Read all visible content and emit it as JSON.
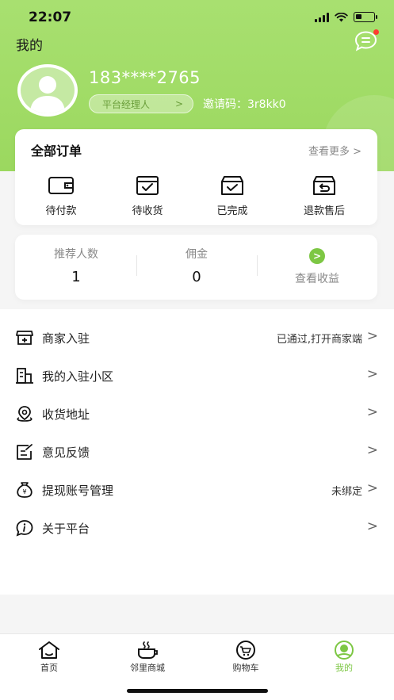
{
  "status_bar": {
    "time": "22:07"
  },
  "header": {
    "title": "我的",
    "icons": [
      "message-icon"
    ]
  },
  "profile": {
    "username": "183****2765",
    "role": "平台经理人",
    "role_chevron": ">",
    "invite_label": "邀请码：",
    "invite_code": "3r8kk0"
  },
  "orders": {
    "title": "全部订单",
    "view_more": "查看更多 >",
    "items": [
      {
        "label": "待付款",
        "icon": "wallet-icon"
      },
      {
        "label": "待收货",
        "icon": "box-check-icon"
      },
      {
        "label": "已完成",
        "icon": "box-done-icon"
      },
      {
        "label": "退款售后",
        "icon": "return-icon"
      }
    ]
  },
  "earnings": {
    "referrals_label": "推荐人数",
    "referrals_value": "1",
    "commission_label": "佣金",
    "commission_value": "0",
    "view_income_icon": ">",
    "view_income_label": "查看收益"
  },
  "menu": [
    {
      "label": "商家入驻",
      "value": "已通过,打开商家端",
      "icon": "merchant-icon"
    },
    {
      "label": "我的入驻小区",
      "value": "",
      "icon": "building-icon"
    },
    {
      "label": "收货地址",
      "value": "",
      "icon": "location-icon"
    },
    {
      "label": "意见反馈",
      "value": "",
      "icon": "feedback-icon"
    },
    {
      "label": "提现账号管理",
      "value": "未绑定",
      "icon": "money-bag-icon"
    },
    {
      "label": "关于平台",
      "value": "",
      "icon": "info-icon"
    }
  ],
  "menu_arrow": ">",
  "tabbar": [
    {
      "label": "首页",
      "icon": "home-icon"
    },
    {
      "label": "邻里商城",
      "icon": "cup-icon"
    },
    {
      "label": "购物车",
      "icon": "cart-icon"
    },
    {
      "label": "我的",
      "icon": "profile-icon",
      "active": true
    }
  ],
  "colors": {
    "accent": "#7dc744",
    "header_bg": "#9bd85f"
  }
}
